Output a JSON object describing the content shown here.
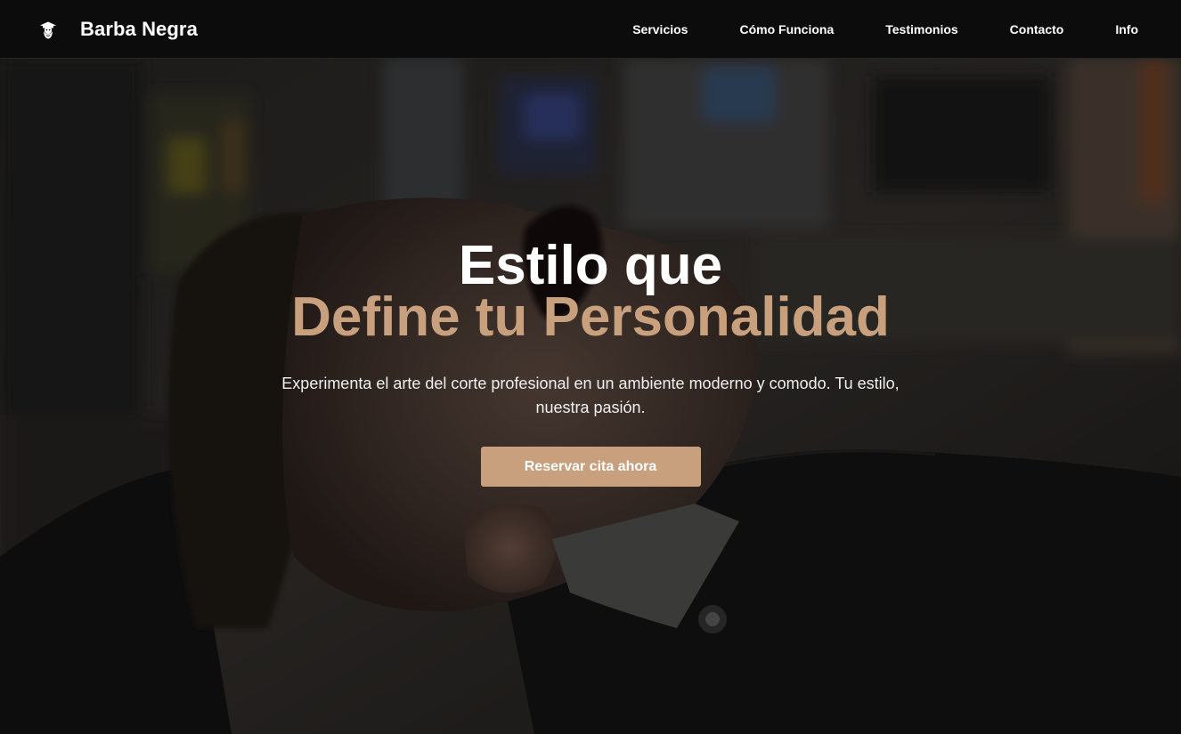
{
  "brand": {
    "name": "Barba Negra",
    "logo_icon": "bearded-man-icon"
  },
  "nav": {
    "items": [
      {
        "label": "Servicios"
      },
      {
        "label": "Cómo Funciona"
      },
      {
        "label": "Testimonios"
      },
      {
        "label": "Contacto"
      },
      {
        "label": "Info"
      }
    ]
  },
  "hero": {
    "title_line1": "Estilo que",
    "title_line2": "Define tu Personalidad",
    "subtitle": "Experimenta el arte del corte profesional en un ambiente moderno y comodo. Tu estilo, nuestra pasión.",
    "cta_label": "Reservar cita ahora",
    "background_image": "barbershop-client-reclined-photo"
  },
  "colors": {
    "accent": "#c8a07d",
    "navbar_bg": "#0c0c0c",
    "text_light": "#ffffff"
  }
}
